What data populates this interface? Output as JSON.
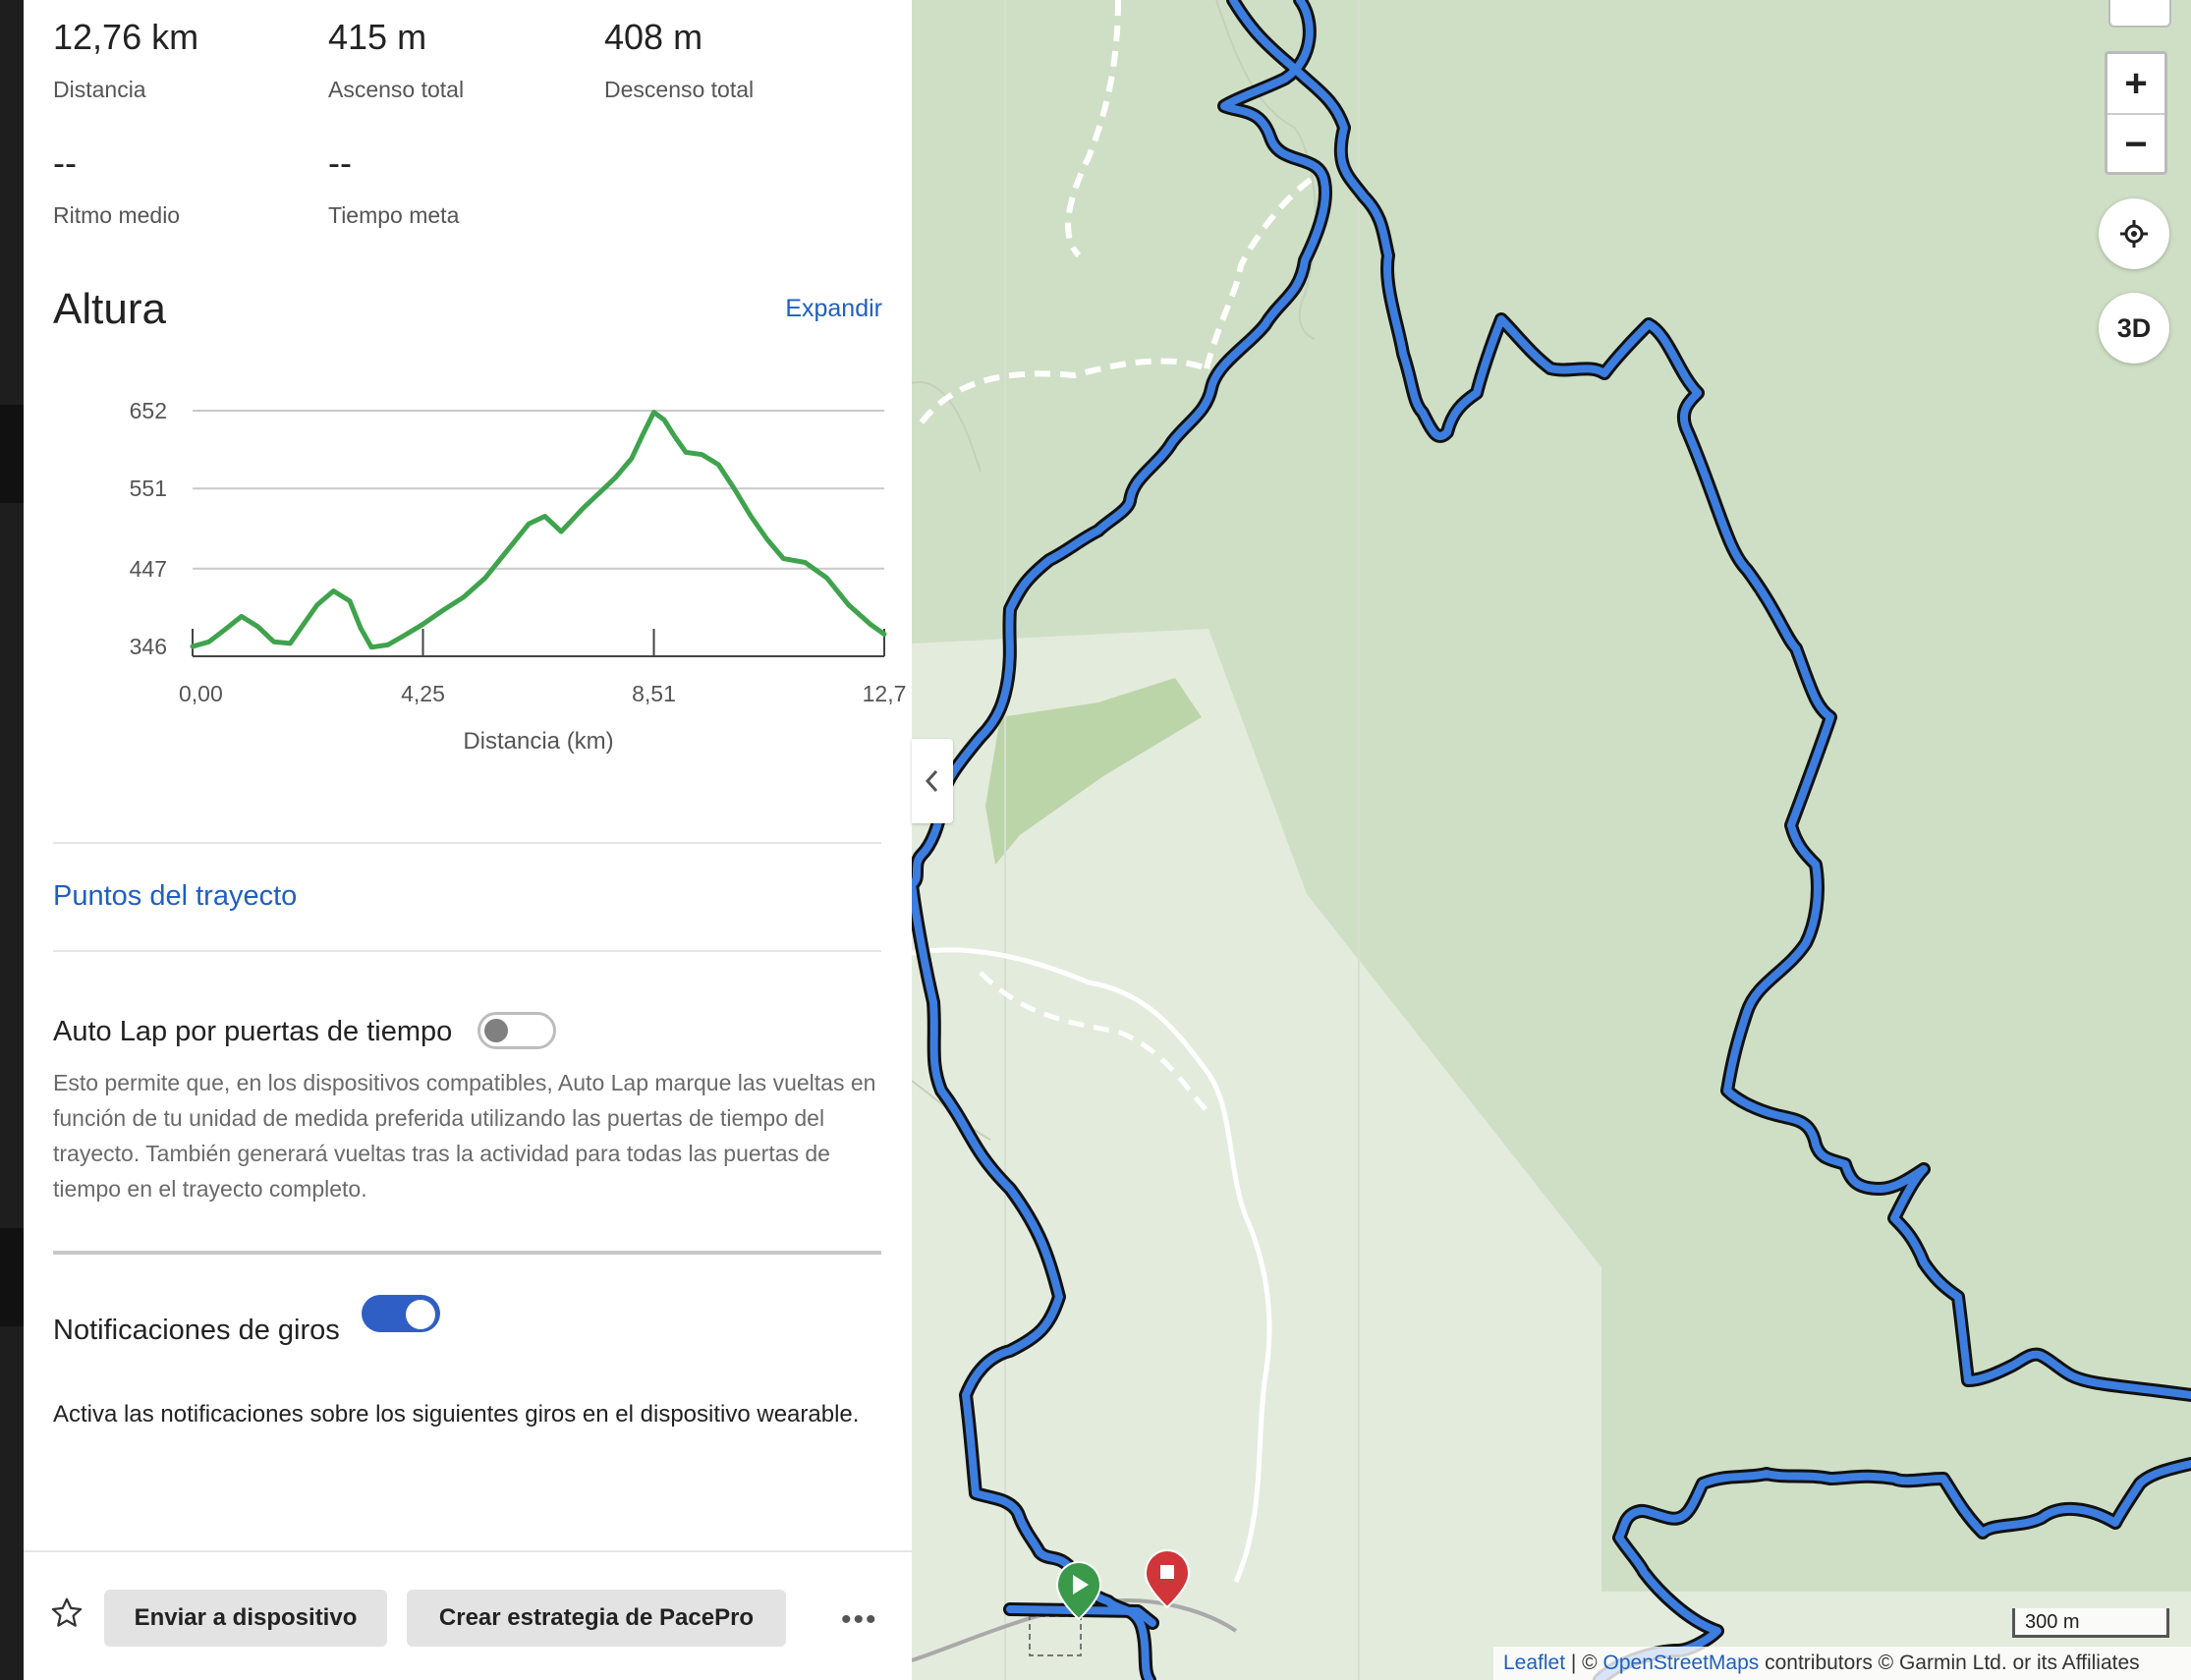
{
  "stats": {
    "distance": {
      "value": "12,76 km",
      "label": "Distancia"
    },
    "ascent": {
      "value": "415 m",
      "label": "Ascenso total"
    },
    "descent": {
      "value": "408 m",
      "label": "Descenso total"
    },
    "avg_pace": {
      "value": "--",
      "label": "Ritmo medio"
    },
    "goal_time": {
      "value": "--",
      "label": "Tiempo meta"
    }
  },
  "elevation": {
    "title": "Altura",
    "expand_label": "Expandir"
  },
  "chart_data": {
    "type": "line",
    "title": "",
    "xlabel": "Distancia (km)",
    "ylabel": "",
    "x_ticks": [
      "0,00",
      "4,25",
      "8,51",
      "12,7"
    ],
    "y_ticks": [
      "652",
      "551",
      "447",
      "346"
    ],
    "xlim": [
      0,
      12.76
    ],
    "ylim": [
      346,
      652
    ],
    "grid": true,
    "color": "#3fa34d",
    "series": [
      {
        "x": [
          0,
          0.3,
          0.6,
          0.9,
          1.2,
          1.5,
          1.8,
          2.0,
          2.3,
          2.6,
          2.9,
          3.1,
          3.3,
          3.6,
          3.9,
          4.25,
          4.6,
          5.0,
          5.4,
          5.8,
          6.2,
          6.5,
          6.8,
          7.0,
          7.2,
          7.5,
          7.8,
          8.1,
          8.3,
          8.51,
          8.7,
          8.9,
          9.1,
          9.4,
          9.7,
          10.0,
          10.3,
          10.6,
          10.9,
          11.3,
          11.7,
          12.1,
          12.5,
          12.76
        ],
        "y": [
          346,
          352,
          368,
          385,
          372,
          352,
          350,
          370,
          400,
          418,
          405,
          370,
          345,
          348,
          360,
          375,
          392,
          410,
          435,
          470,
          505,
          515,
          495,
          510,
          525,
          545,
          565,
          590,
          620,
          650,
          640,
          618,
          598,
          595,
          582,
          550,
          515,
          485,
          460,
          455,
          435,
          400,
          375,
          362
        ]
      }
    ]
  },
  "waypoints_link": "Puntos del trayecto",
  "autolap": {
    "label": "Auto Lap por puertas de tiempo",
    "enabled": false,
    "description": "Esto permite que, en los dispositivos compatibles, Auto Lap marque las vueltas en función de tu unidad de medida preferida utilizando las puertas de tiempo del trayecto. También generará vueltas tras la actividad para todas las puertas de tiempo en el trayecto completo."
  },
  "turn_notifications": {
    "label": "Notificaciones de giros",
    "enabled": true,
    "description": "Activa las notificaciones sobre los siguientes giros en el dispositivo wearable."
  },
  "footer": {
    "send_button": "Enviar a dispositivo",
    "pacepro_button": "Crear estrategia de PacePro",
    "more_label": "•••",
    "favorite_icon": "star-icon"
  },
  "map": {
    "zoom_in": "+",
    "zoom_out": "−",
    "btn_3d": "3D",
    "scale_label": "300 m",
    "attribution": {
      "leaflet": "Leaflet",
      "sep": " | © ",
      "osm": "OpenStreetMaps",
      "rest": " contributors © Garmin Ltd. or its Affiliates"
    },
    "route_color": "#3c7de0",
    "forest_color": "#cfdfc5"
  }
}
